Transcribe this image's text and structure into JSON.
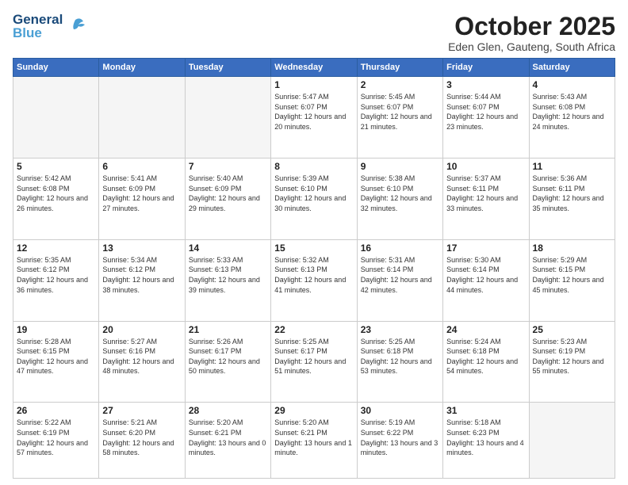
{
  "header": {
    "logo_line1": "General",
    "logo_line2": "Blue",
    "month": "October 2025",
    "location": "Eden Glen, Gauteng, South Africa"
  },
  "weekdays": [
    "Sunday",
    "Monday",
    "Tuesday",
    "Wednesday",
    "Thursday",
    "Friday",
    "Saturday"
  ],
  "weeks": [
    [
      {
        "day": "",
        "empty": true
      },
      {
        "day": "",
        "empty": true
      },
      {
        "day": "",
        "empty": true
      },
      {
        "day": "1",
        "rise": "5:47 AM",
        "set": "6:07 PM",
        "daylight": "12 hours and 20 minutes."
      },
      {
        "day": "2",
        "rise": "5:45 AM",
        "set": "6:07 PM",
        "daylight": "12 hours and 21 minutes."
      },
      {
        "day": "3",
        "rise": "5:44 AM",
        "set": "6:07 PM",
        "daylight": "12 hours and 23 minutes."
      },
      {
        "day": "4",
        "rise": "5:43 AM",
        "set": "6:08 PM",
        "daylight": "12 hours and 24 minutes."
      }
    ],
    [
      {
        "day": "5",
        "rise": "5:42 AM",
        "set": "6:08 PM",
        "daylight": "12 hours and 26 minutes."
      },
      {
        "day": "6",
        "rise": "5:41 AM",
        "set": "6:09 PM",
        "daylight": "12 hours and 27 minutes."
      },
      {
        "day": "7",
        "rise": "5:40 AM",
        "set": "6:09 PM",
        "daylight": "12 hours and 29 minutes."
      },
      {
        "day": "8",
        "rise": "5:39 AM",
        "set": "6:10 PM",
        "daylight": "12 hours and 30 minutes."
      },
      {
        "day": "9",
        "rise": "5:38 AM",
        "set": "6:10 PM",
        "daylight": "12 hours and 32 minutes."
      },
      {
        "day": "10",
        "rise": "5:37 AM",
        "set": "6:11 PM",
        "daylight": "12 hours and 33 minutes."
      },
      {
        "day": "11",
        "rise": "5:36 AM",
        "set": "6:11 PM",
        "daylight": "12 hours and 35 minutes."
      }
    ],
    [
      {
        "day": "12",
        "rise": "5:35 AM",
        "set": "6:12 PM",
        "daylight": "12 hours and 36 minutes."
      },
      {
        "day": "13",
        "rise": "5:34 AM",
        "set": "6:12 PM",
        "daylight": "12 hours and 38 minutes."
      },
      {
        "day": "14",
        "rise": "5:33 AM",
        "set": "6:13 PM",
        "daylight": "12 hours and 39 minutes."
      },
      {
        "day": "15",
        "rise": "5:32 AM",
        "set": "6:13 PM",
        "daylight": "12 hours and 41 minutes."
      },
      {
        "day": "16",
        "rise": "5:31 AM",
        "set": "6:14 PM",
        "daylight": "12 hours and 42 minutes."
      },
      {
        "day": "17",
        "rise": "5:30 AM",
        "set": "6:14 PM",
        "daylight": "12 hours and 44 minutes."
      },
      {
        "day": "18",
        "rise": "5:29 AM",
        "set": "6:15 PM",
        "daylight": "12 hours and 45 minutes."
      }
    ],
    [
      {
        "day": "19",
        "rise": "5:28 AM",
        "set": "6:15 PM",
        "daylight": "12 hours and 47 minutes."
      },
      {
        "day": "20",
        "rise": "5:27 AM",
        "set": "6:16 PM",
        "daylight": "12 hours and 48 minutes."
      },
      {
        "day": "21",
        "rise": "5:26 AM",
        "set": "6:17 PM",
        "daylight": "12 hours and 50 minutes."
      },
      {
        "day": "22",
        "rise": "5:25 AM",
        "set": "6:17 PM",
        "daylight": "12 hours and 51 minutes."
      },
      {
        "day": "23",
        "rise": "5:25 AM",
        "set": "6:18 PM",
        "daylight": "12 hours and 53 minutes."
      },
      {
        "day": "24",
        "rise": "5:24 AM",
        "set": "6:18 PM",
        "daylight": "12 hours and 54 minutes."
      },
      {
        "day": "25",
        "rise": "5:23 AM",
        "set": "6:19 PM",
        "daylight": "12 hours and 55 minutes."
      }
    ],
    [
      {
        "day": "26",
        "rise": "5:22 AM",
        "set": "6:19 PM",
        "daylight": "12 hours and 57 minutes."
      },
      {
        "day": "27",
        "rise": "5:21 AM",
        "set": "6:20 PM",
        "daylight": "12 hours and 58 minutes."
      },
      {
        "day": "28",
        "rise": "5:20 AM",
        "set": "6:21 PM",
        "daylight": "13 hours and 0 minutes."
      },
      {
        "day": "29",
        "rise": "5:20 AM",
        "set": "6:21 PM",
        "daylight": "13 hours and 1 minute."
      },
      {
        "day": "30",
        "rise": "5:19 AM",
        "set": "6:22 PM",
        "daylight": "13 hours and 3 minutes."
      },
      {
        "day": "31",
        "rise": "5:18 AM",
        "set": "6:23 PM",
        "daylight": "13 hours and 4 minutes."
      },
      {
        "day": "",
        "empty": true
      }
    ]
  ]
}
